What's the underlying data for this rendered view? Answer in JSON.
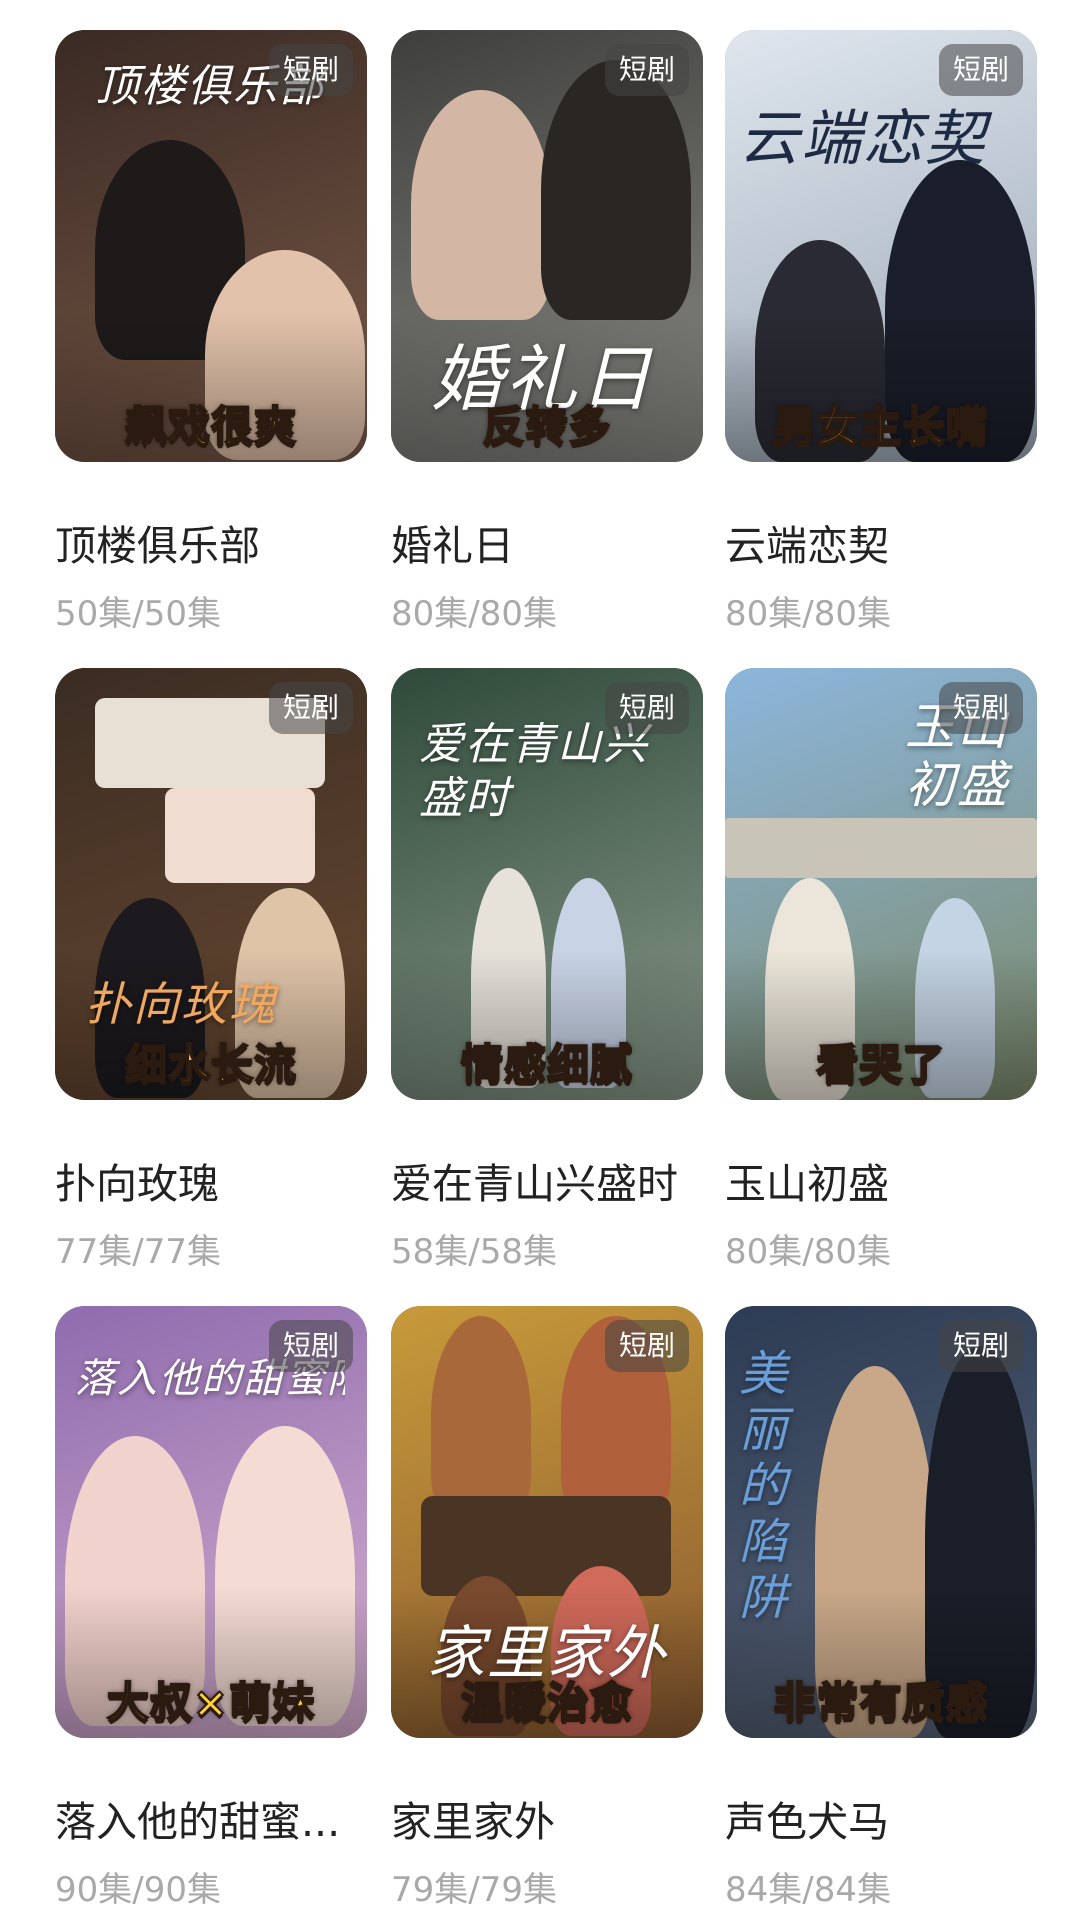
{
  "badge_label": "短剧",
  "items": [
    {
      "poster_title": "顶楼俱乐部",
      "tag": "飙戏很爽",
      "title": "顶楼俱乐部",
      "episodes": "50集/50集",
      "colors": {
        "top": "#3a2a24",
        "bottom": "#7a5a48",
        "accent": "#e8c8b0"
      }
    },
    {
      "poster_title": "婚礼日",
      "tag": "反转多",
      "title": "婚礼日",
      "episodes": "80集/80集",
      "colors": {
        "top": "#3e3e3c",
        "bottom": "#8a8a86",
        "accent": "#d8c8b8"
      }
    },
    {
      "poster_title": "云端恋契",
      "tag": "男女主长嘴",
      "title": "云端恋契",
      "episodes": "80集/80集",
      "colors": {
        "top": "#dfe6ee",
        "bottom": "#9aa6b4",
        "accent": "#1c2230"
      }
    },
    {
      "poster_title": "扑向玫瑰",
      "tag": "细水长流",
      "title": "扑向玫瑰",
      "episodes": "77集/77集",
      "colors": {
        "top": "#3a2c22",
        "bottom": "#6a4a32",
        "accent": "#d8a070"
      }
    },
    {
      "poster_title": "爱在青山兴盛时",
      "tag": "情感细腻",
      "title": "爱在青山兴盛时",
      "episodes": "58集/58集",
      "colors": {
        "top": "#2f4a3a",
        "bottom": "#8a9a8c",
        "accent": "#e8e4dc"
      }
    },
    {
      "poster_title": "玉山初盛",
      "tag": "看哭了",
      "title": "玉山初盛",
      "episodes": "80集/80集",
      "colors": {
        "top": "#8cb6dc",
        "bottom": "#7c8a6a",
        "accent": "#f4f0e8"
      }
    },
    {
      "poster_title": "落入他的甜蜜陷阱",
      "tag": "大叔×萌妹",
      "title": "落入他的甜蜜...",
      "episodes": "90集/90集",
      "colors": {
        "top": "#8e6cae",
        "bottom": "#d8b0d0",
        "accent": "#f4e0e0"
      }
    },
    {
      "poster_title": "家里家外",
      "tag": "温暖治愈",
      "title": "家里家外",
      "episodes": "79集/79集",
      "colors": {
        "top": "#c89a3a",
        "bottom": "#8a5a30",
        "accent": "#f4d8a0"
      }
    },
    {
      "poster_title": "美丽的陷阱",
      "tag": "非常有质感",
      "title": "声色犬马",
      "episodes": "84集/84集",
      "colors": {
        "top": "#2c3c54",
        "bottom": "#5a6478",
        "accent": "#c8b8a0"
      }
    }
  ]
}
